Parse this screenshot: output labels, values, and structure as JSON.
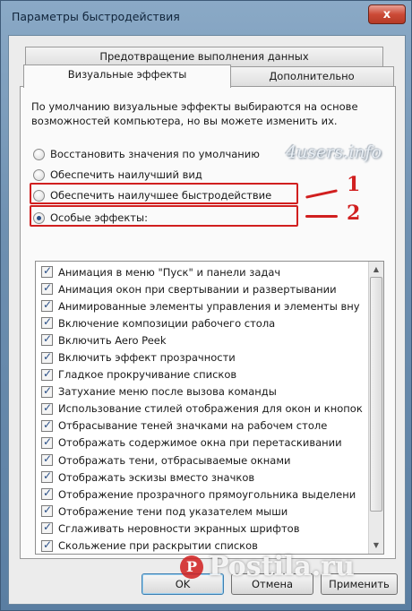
{
  "window": {
    "title": "Параметры быстродействия",
    "close_label": "x"
  },
  "tabs": {
    "row1": "Предотвращение выполнения данных",
    "visual": "Визуальные эффекты",
    "advanced": "Дополнительно"
  },
  "description": "По умолчанию визуальные эффекты выбираются на основе возможностей компьютера, но вы можете изменить их.",
  "radios": [
    {
      "label": "Восстановить значения по умолчанию",
      "checked": false
    },
    {
      "label": "Обеспечить наилучший вид",
      "checked": false
    },
    {
      "label": "Обеспечить наилучшее быстродействие",
      "checked": false
    },
    {
      "label": "Особые эффекты:",
      "checked": true
    }
  ],
  "annotations": {
    "callout1": "1",
    "callout2": "2",
    "highlight_color": "#d11f1f",
    "watermark": "4users.info"
  },
  "effects": [
    "Анимация в меню \"Пуск\" и панели задач",
    "Анимация окон при свертывании и развертывании",
    "Анимированные элементы управления и элементы вну",
    "Включение композиции рабочего стола",
    "Включить Aero Peek",
    "Включить эффект прозрачности",
    "Гладкое прокручивание списков",
    "Затухание меню после вызова команды",
    "Использование стилей отображения для окон и кнопок",
    "Отбрасывание теней значками на рабочем столе",
    "Отображать содержимое окна при перетаскивании",
    "Отображать тени, отбрасываемые окнами",
    "Отображать эскизы вместо значков",
    "Отображение прозрачного прямоугольника выделени",
    "Отображение тени под указателем мыши",
    "Сглаживать неровности экранных шрифтов",
    "Скольжение при раскрытии списков"
  ],
  "buttons": {
    "ok": "OK",
    "cancel": "Отмена",
    "apply": "Применить"
  },
  "overlay_logo": "Postila.ru",
  "accent_color": "#2a4f86"
}
